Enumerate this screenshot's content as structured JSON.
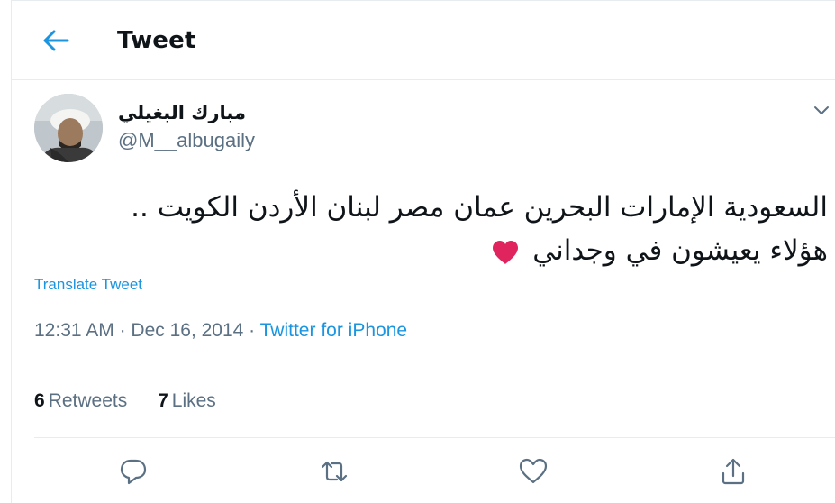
{
  "header": {
    "title": "Tweet",
    "back_icon": "arrow-left-icon"
  },
  "author": {
    "display_name": "مبارك البغيلي",
    "handle": "@M__albugaily"
  },
  "tweet": {
    "line1": "السعودية الإمارات البحرين عمان مصر لبنان الأردن الكويت ..",
    "line2": "هؤلاء يعيشون في وجداني",
    "emoji": "red-heart-icon"
  },
  "translate_label": "Translate Tweet",
  "meta": {
    "time": "12:31 AM",
    "sep": " · ",
    "date": "Dec 16, 2014",
    "source": "Twitter for iPhone"
  },
  "stats": {
    "retweets_count": "6",
    "retweets_label": "Retweets",
    "likes_count": "7",
    "likes_label": "Likes"
  },
  "actions": [
    "reply-icon",
    "retweet-icon",
    "like-icon",
    "share-icon"
  ],
  "colors": {
    "accent": "#1b95e0",
    "text": "#0f1419",
    "muted": "#5b7083",
    "border": "#e6ecf0",
    "heart": "#e0245e"
  }
}
